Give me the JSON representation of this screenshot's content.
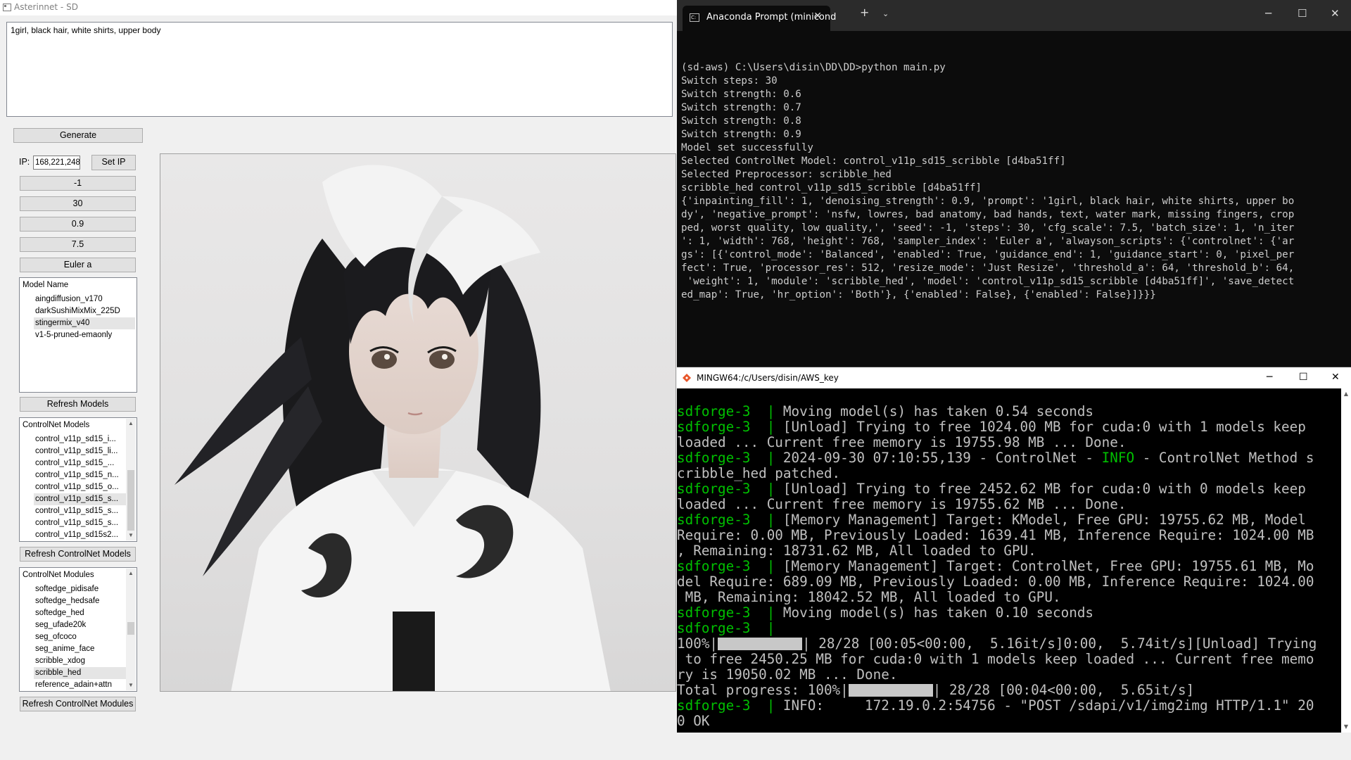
{
  "app": {
    "title": "Asterinnet - SD",
    "prompt": "1girl, black hair, white shirts, upper body",
    "generate_label": "Generate",
    "ip_label": "IP:",
    "ip_value": "168,221,248",
    "set_ip_label": "Set IP",
    "seed": "-1",
    "steps": "30",
    "strength": "0.9",
    "cfg": "7.5",
    "sampler": "Euler a",
    "model_list": {
      "header": "Model Name",
      "items": [
        "aingdiffusion_v170",
        "darkSushiMixMix_225D",
        "stingermix_v40",
        "v1-5-pruned-emaonly"
      ],
      "selected_index": 2
    },
    "refresh_models_label": "Refresh Models",
    "controlnet_models": {
      "header": "ControlNet Models",
      "items": [
        "control_v11p_sd15_i...",
        "control_v11p_sd15_li...",
        "control_v11p_sd15_...",
        "control_v11p_sd15_n...",
        "control_v11p_sd15_o...",
        "control_v11p_sd15_s...",
        "control_v11p_sd15_s...",
        "control_v11p_sd15_s...",
        "control_v11p_sd15s2..."
      ],
      "selected_index": 5
    },
    "refresh_controlnet_models_label": "Refresh ControlNet Models",
    "controlnet_modules": {
      "header": "ControlNet Modules",
      "items": [
        "softedge_pidisafe",
        "softedge_hedsafe",
        "softedge_hed",
        "seg_ufade20k",
        "seg_ofcoco",
        "seg_anime_face",
        "scribble_xdog",
        "scribble_hed",
        "reference_adain+attn"
      ],
      "selected_index": 7
    },
    "refresh_controlnet_modules_label": "Refresh ControlNet Modules"
  },
  "terminal": {
    "tab_title": "Anaconda Prompt (minicond",
    "lines": [
      "(sd-aws) C:\\Users\\disin\\DD\\DD>python main.py",
      "Switch steps: 30",
      "Switch strength: 0.6",
      "Switch strength: 0.7",
      "Switch strength: 0.8",
      "Switch strength: 0.9",
      "Model set successfully",
      "Selected ControlNet Model: control_v11p_sd15_scribble [d4ba51ff]",
      "Selected Preprocessor: scribble_hed",
      "scribble_hed control_v11p_sd15_scribble [d4ba51ff]",
      "{'inpainting_fill': 1, 'denoising_strength': 0.9, 'prompt': '1girl, black hair, white shirts, upper bo",
      "dy', 'negative_prompt': 'nsfw, lowres, bad anatomy, bad hands, text, water mark, missing fingers, crop",
      "ped, worst quality, low quality,', 'seed': -1, 'steps': 30, 'cfg_scale': 7.5, 'batch_size': 1, 'n_iter",
      "': 1, 'width': 768, 'height': 768, 'sampler_index': 'Euler a', 'alwayson_scripts': {'controlnet': {'ar",
      "gs': [{'control_mode': 'Balanced', 'enabled': True, 'guidance_end': 1, 'guidance_start': 0, 'pixel_per",
      "fect': True, 'processor_res': 512, 'resize_mode': 'Just Resize', 'threshold_a': 64, 'threshold_b': 64,",
      " 'weight': 1, 'module': 'scribble_hed', 'model': 'control_v11p_sd15_scribble [d4ba51ff]', 'save_detect",
      "ed_map': True, 'hr_option': 'Both'}, {'enabled': False}, {'enabled': False}]}}}"
    ]
  },
  "mingw": {
    "title": "MINGW64:/c/Users/disin/AWS_key",
    "prefix": "sdforge-3",
    "sep": "|",
    "log": {
      "l1": "Moving model(s) has taken 0.54 seconds",
      "l2a": "[Unload] Trying to free 1024.00 MB for cuda:0 with 1 models keep",
      "l2b": "loaded ... Current free memory is 19755.98 MB ... Done.",
      "l3a": "2024-09-30 07:10:55,139 - ControlNet - ",
      "l3info": "INFO",
      "l3b": " - ControlNet Method s",
      "l3c": "cribble_hed patched.",
      "l4a": "[Unload] Trying to free 2452.62 MB for cuda:0 with 0 models keep",
      "l4b": "loaded ... Current free memory is 19755.62 MB ... Done.",
      "l5a": "[Memory Management] Target: KModel, Free GPU: 19755.62 MB, Model",
      "l5b": "Require: 0.00 MB, Previously Loaded: 1639.41 MB, Inference Require: 1024.00 MB",
      "l5c": ", Remaining: 18731.62 MB, All loaded to GPU.",
      "l6a": "[Memory Management] Target: ControlNet, Free GPU: 19755.61 MB, Mo",
      "l6b": "del Require: 689.09 MB, Previously Loaded: 0.00 MB, Inference Require: 1024.00",
      "l6c": " MB, Remaining: 18042.52 MB, All loaded to GPU.",
      "l7": "Moving model(s) has taken 0.10 seconds",
      "p1a": "100%|",
      "p1b": "| 28/28 [00:05<00:00,  5.16it/s]0:00,  5.74it/s][Unload] Trying",
      "p1c": " to free 2450.25 MB for cuda:0 with 1 models keep loaded ... Current free memo",
      "p1d": "ry is 19050.02 MB ... Done.",
      "t1a": "Total progress: 100%|",
      "t1b": "| 28/28 [00:04<00:00,  5.65it/s]",
      "l8": "INFO:     172.19.0.2:54756 - \"POST /sdapi/v1/img2img HTTP/1.1\" 20",
      "l8b": "0 OK"
    }
  },
  "colors": {
    "prefix_green": "#00c000",
    "terminal_bg": "#0c0c0c"
  }
}
